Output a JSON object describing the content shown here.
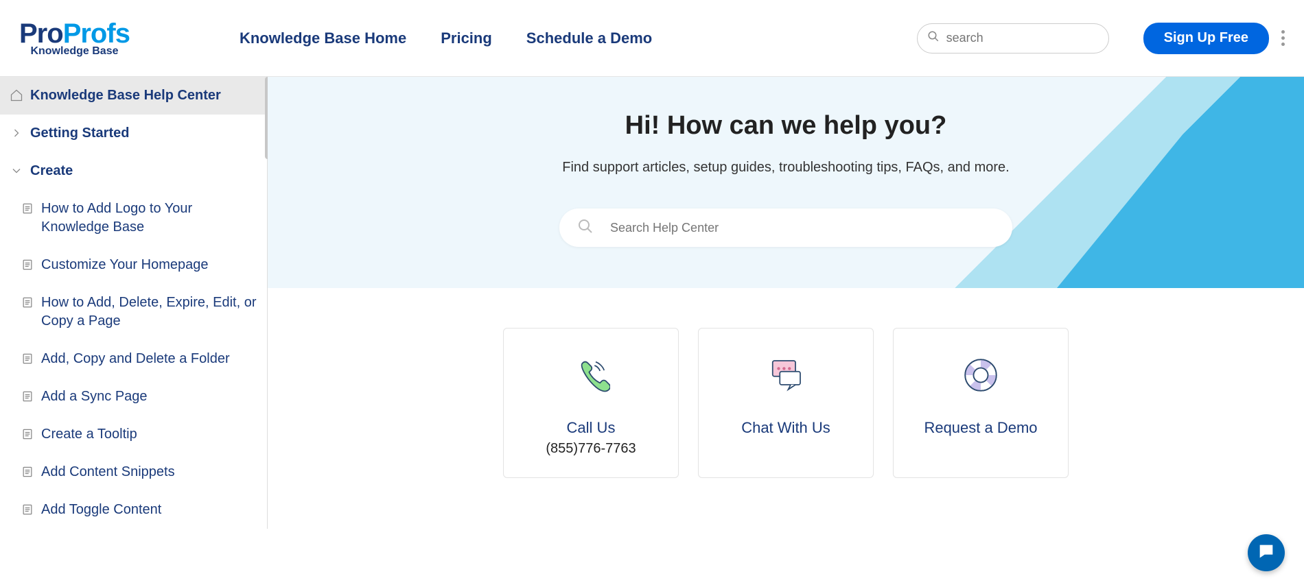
{
  "logo": {
    "part1": "Pro",
    "part2": "Profs",
    "sub": "Knowledge Base"
  },
  "nav": {
    "home": "Knowledge Base Home",
    "pricing": "Pricing",
    "demo": "Schedule a Demo"
  },
  "top_search_placeholder": "search",
  "signup": "Sign Up Free",
  "sidebar": {
    "root": "Knowledge Base Help Center",
    "getting_started": "Getting Started",
    "create": "Create",
    "children": [
      "How to Add Logo to Your Knowledge Base",
      "Customize Your Homepage",
      "How to Add, Delete, Expire, Edit, or Copy a Page",
      "Add, Copy and Delete a Folder",
      "Add a Sync Page",
      "Create a Tooltip",
      "Add Content Snippets",
      "Add Toggle Content"
    ]
  },
  "hero": {
    "title": "Hi! How can we help you?",
    "subtitle": "Find support articles, setup guides, troubleshooting tips, FAQs, and more.",
    "search_placeholder": "Search Help Center"
  },
  "cards": {
    "call": {
      "title": "Call Us",
      "sub": "(855)776-7763"
    },
    "chat": {
      "title": "Chat With Us"
    },
    "demo": {
      "title": "Request a Demo"
    }
  }
}
